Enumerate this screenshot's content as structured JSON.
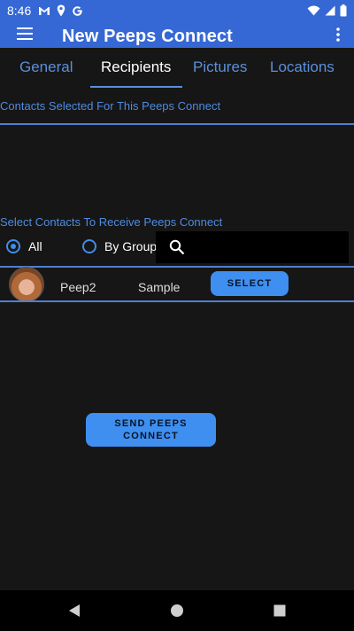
{
  "status_bar": {
    "time": "8:46",
    "left_icons": [
      "gmail-icon",
      "location-icon",
      "google-icon"
    ],
    "right_icons": [
      "wifi-icon",
      "cell-signal-icon",
      "battery-icon"
    ]
  },
  "toolbar": {
    "title": "New Peeps Connect",
    "menu_icon": "hamburger-menu-icon",
    "more_icon": "more-vertical-icon"
  },
  "tabs": [
    {
      "label": "General",
      "active": false
    },
    {
      "label": "Recipients",
      "active": true
    },
    {
      "label": "Pictures",
      "active": false
    },
    {
      "label": "Locations",
      "active": false
    }
  ],
  "selected_section": {
    "label": "Contacts Selected For This Peeps Connect"
  },
  "select_section": {
    "label": "Select Contacts To Receive Peeps Connect",
    "filter_all_label": "All",
    "filter_group_label": "By Group",
    "selected_filter": "All",
    "search_placeholder": ""
  },
  "contacts": [
    {
      "first_name": "Peep2",
      "last_name": "Sample",
      "action_label": "SELECT"
    }
  ],
  "send_button": {
    "line1": "SEND PEEPS",
    "line2": "CONNECT"
  },
  "colors": {
    "primary": "#3568d4",
    "accent": "#3e8ff0",
    "background": "#161616",
    "label_blue": "#4f8be0"
  }
}
